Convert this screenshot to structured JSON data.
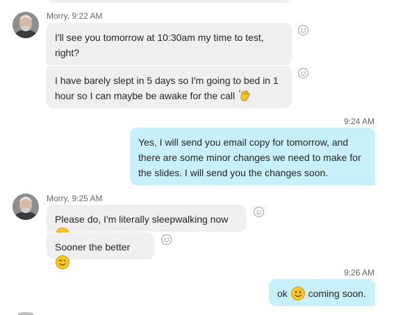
{
  "messages": [
    {
      "sender": "Morry",
      "time": "9:22 AM",
      "header": "Morry, 9:22 AM",
      "text": "I'll see you tomorrow at 10:30am my time to test, right?"
    },
    {
      "sender": "Morry",
      "text": "I have barely slept in 5 days so I'm going to bed in 1 hour so I can maybe be awake for the call",
      "emoji": "wave-hand-emoji"
    },
    {
      "sender": "me",
      "time": "9:24 AM",
      "text": "Yes, I will send you email copy for tomorrow, and there are some minor changes we need to make for the slides. I will send you the changes soon."
    },
    {
      "sender": "Morry",
      "time": "9:25 AM",
      "header": "Morry, 9:25 AM",
      "text": "Please do, I'm literally sleepwalking now",
      "emoji": "wink-emoji"
    },
    {
      "sender": "Morry",
      "text": "Sooner the better",
      "emoji": "wink-emoji"
    },
    {
      "sender": "me",
      "time": "9:26 AM",
      "text_before": "ok",
      "text_after": "coming soon.",
      "emoji": "smile-emoji"
    }
  ],
  "colors": {
    "incoming_bubble": "#efefef",
    "outgoing_bubble": "#c7f0fb",
    "emoji": "#f9c62b"
  }
}
